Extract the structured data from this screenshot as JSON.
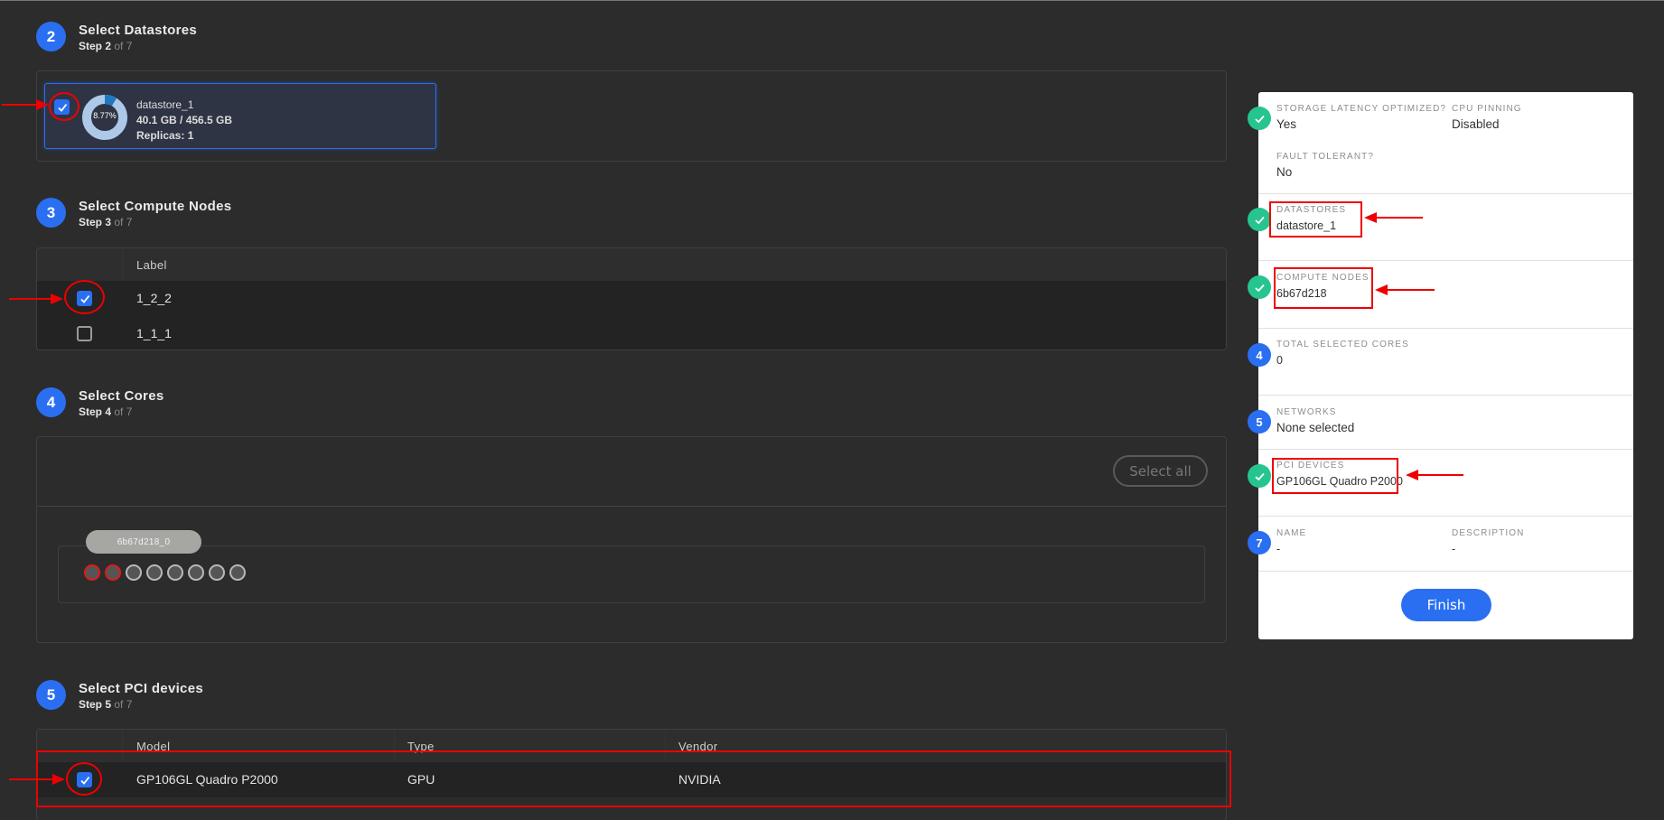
{
  "steps": [
    {
      "number": "2",
      "title": "Select Datastores",
      "step_label": "Step 2",
      "of_label": "of 7"
    },
    {
      "number": "3",
      "title": "Select Compute Nodes",
      "step_label": "Step 3",
      "of_label": "of 7"
    },
    {
      "number": "4",
      "title": "Select Cores",
      "step_label": "Step 4",
      "of_label": "of 7"
    },
    {
      "number": "5",
      "title": "Select PCI devices",
      "step_label": "Step 5",
      "of_label": "of 7"
    }
  ],
  "datastores": [
    {
      "name": "datastore_1",
      "usage": "40.1 GB / 456.5 GB",
      "replicas": "Replicas: 1",
      "percent_label": "8.77%",
      "percent": 8.77,
      "checked": true
    }
  ],
  "compute_nodes": {
    "columns": [
      "Label"
    ],
    "rows": [
      {
        "label": "1_2_2",
        "checked": true
      },
      {
        "label": "1_1_1",
        "checked": false
      }
    ]
  },
  "cores": {
    "select_all_label": "Select all",
    "groups": [
      {
        "name": "6b67d218_0",
        "cores": 8,
        "highlighted": [
          0,
          1
        ]
      }
    ]
  },
  "pci_devices": {
    "columns": [
      "Model",
      "Type",
      "Vendor"
    ],
    "rows": [
      {
        "model": "GP106GL Quadro P2000",
        "type": "GPU",
        "vendor": "NVIDIA",
        "checked": true
      }
    ]
  },
  "summary": {
    "storage_latency_label": "STORAGE LATENCY OPTIMIZED?",
    "storage_latency_value": "Yes",
    "cpu_pinning_label": "CPU PINNING",
    "cpu_pinning_value": "Disabled",
    "fault_tolerant_label": "FAULT TOLERANT?",
    "fault_tolerant_value": "No",
    "datastores_label": "DATASTORES",
    "datastores_value": "datastore_1",
    "compute_nodes_label": "COMPUTE NODES",
    "compute_nodes_value": "6b67d218",
    "total_cores_label": "TOTAL SELECTED CORES",
    "total_cores_value": "0",
    "total_cores_step": "4",
    "networks_label": "NETWORKS",
    "networks_value": "None selected",
    "networks_step": "5",
    "pci_label": "PCI DEVICES",
    "pci_value": "GP106GL Quadro P2000",
    "name_label": "NAME",
    "name_value": "-",
    "name_step": "7",
    "description_label": "DESCRIPTION",
    "description_value": "-",
    "finish_label": "Finish"
  },
  "colors": {
    "accent": "#2a6ff2",
    "success": "#26c590",
    "annotation": "#ee0000",
    "donut_used": "#1f78c0",
    "donut_free": "#aec8e8"
  }
}
